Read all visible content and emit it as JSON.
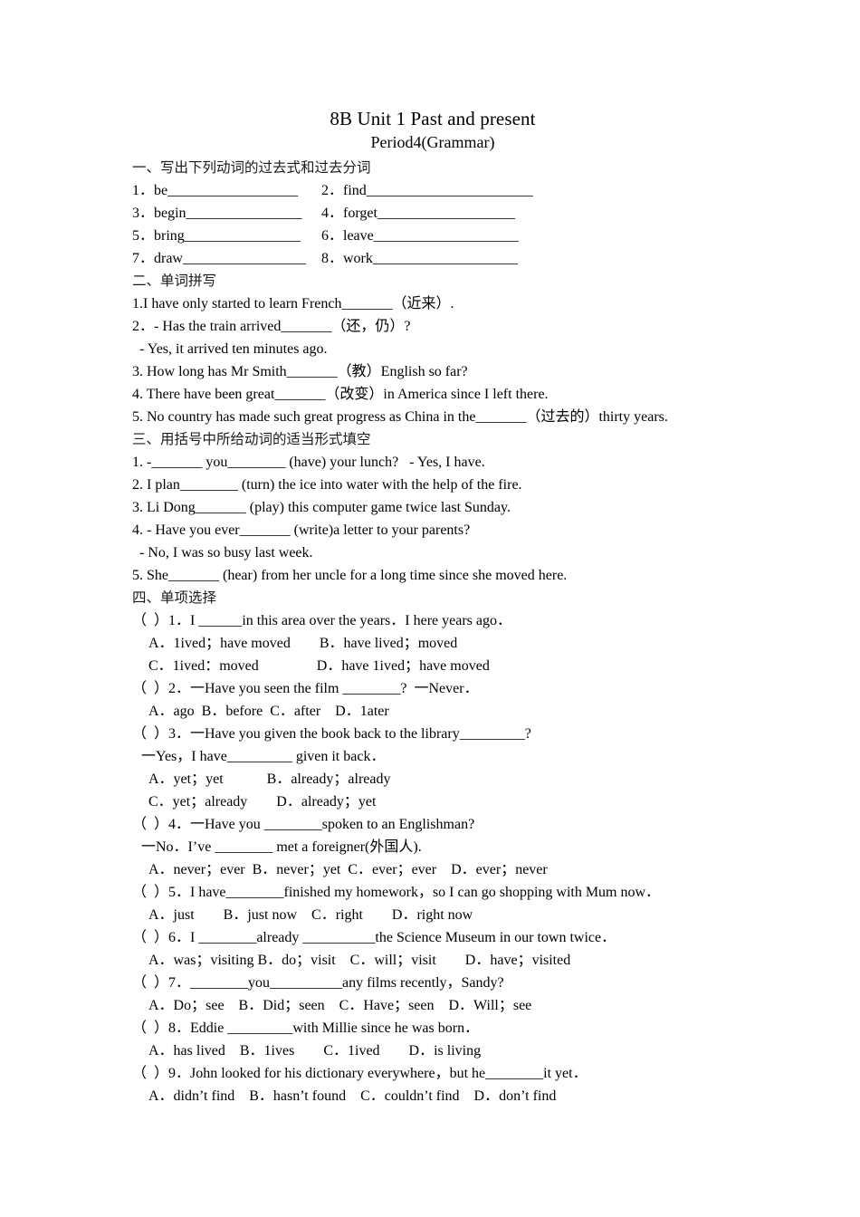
{
  "title": "8B Unit 1 Past and present",
  "subtitle": "Period4(Grammar)",
  "section1": {
    "heading": "一、写出下列动词的过去式和过去分词",
    "items": [
      "1．be__________________",
      "2．find_______________________",
      "3．begin________________",
      "4．forget___________________",
      "5．bring________________",
      "6．leave____________________",
      "7．draw_________________",
      "8．work____________________"
    ]
  },
  "section2": {
    "heading": "二、单词拼写",
    "lines": [
      "1.I have only started to learn French_______（近来）.",
      "2．- Has the train arrived_______（还，仍）?",
      "  - Yes, it arrived ten minutes ago.",
      "3. How long has Mr Smith_______（教）English so far?",
      "4. There have been great_______（改变）in America since I left there.",
      "5. No country has made such great progress as China in the_______（过去的）thirty years."
    ]
  },
  "section3": {
    "heading": "三、用括号中所给动词的适当形式填空",
    "lines": [
      "1. -_______ you________ (have) your lunch?   - Yes, I have.",
      "2. I plan________ (turn) the ice into water with the help of the fire.",
      "3. Li Dong_______ (play) this computer game twice last Sunday.",
      "4. - Have you ever_______ (write)a letter to your parents?",
      "  - No, I was so busy last week.",
      "5. She_______ (hear) from her uncle for a long time since she moved here."
    ]
  },
  "section4": {
    "heading": "四、单项选择",
    "questions": [
      {
        "stem": "（  ）1．I ______in this area over the years．I here years ago．",
        "options": [
          "A．1ived；have moved　　B．have lived；moved",
          "C．1ived：moved　　　　D．have 1ived；have moved"
        ]
      },
      {
        "stem": "（  ）2．一Have you seen the film ________?  一Never．",
        "options": [
          "A．ago  B．before  C．after　D．1ater"
        ]
      },
      {
        "stem": "（  ）3．一Have you given the book back to the library_________?",
        "extra": "一Yes，I have_________ given it back．",
        "options": [
          "A．yet；yet　　　B．already；already",
          "C．yet；already　　D．already；yet"
        ]
      },
      {
        "stem": "（  ）4．一Have you ________spoken to an Englishman?",
        "extra": "一No．I’ve ________ met a foreigner(外国人).",
        "options": [
          "A．never；ever  B．never；yet  C．ever；ever　D．ever；never"
        ]
      },
      {
        "stem": "（  ）5．I have________finished my homework，so I can go shopping with Mum now．",
        "options": [
          "A．just　　B．just now　C．right　　D．right now"
        ]
      },
      {
        "stem": "（  ）6．I ________already __________the Science Museum in our town twice．",
        "options": [
          "A．was；visiting B．do；visit　C．will；visit　　D．have；visited"
        ]
      },
      {
        "stem": "（  ）7．________you__________any films recently，Sandy?",
        "options": [
          "A．Do；see　B．Did；seen　C．Have；seen　D．Will；see"
        ]
      },
      {
        "stem": "（  ）8．Eddie _________with Millie since he was born．",
        "options": [
          "A．has lived　B．1ives　　C．1ived　　D．is living"
        ]
      },
      {
        "stem": "（  ）9．John looked for his dictionary everywhere，but he________it yet．",
        "options": [
          "A．didn’t find　B．hasn’t found　C．couldn’t find　D．don’t find"
        ]
      }
    ]
  }
}
